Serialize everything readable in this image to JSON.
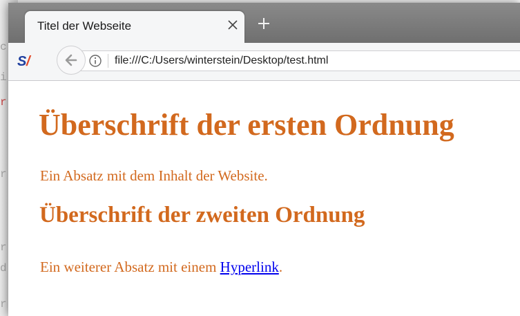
{
  "background_editor": {
    "fragments": [
      "c",
      "i",
      "r",
      "r",
      "r",
      "d",
      "r"
    ]
  },
  "browser": {
    "tab": {
      "title": "Titel der Webseite",
      "close_glyph": "×"
    },
    "new_tab_glyph": "+",
    "toolbar": {
      "extension_icon": "selfhtml-logo-icon",
      "back_icon": "back-arrow-icon",
      "info_icon": "info-icon"
    },
    "url": "file:///C:/Users/winterstein/Desktop/test.html"
  },
  "page": {
    "heading1": "Überschrift der ersten Ordnung",
    "paragraph1": "Ein Absatz mit dem Inhalt der Website.",
    "heading2": "Überschrift der zweiten Ordnung",
    "paragraph2_prefix": "Ein weiterer Absatz mit einem ",
    "link_text": "Hyperlink",
    "paragraph2_suffix": "."
  },
  "colors": {
    "text_accent": "#d2691e",
    "link": "#0000ee",
    "chrome_bg": "#f5f6f7",
    "tabbar_bg": "#7d7d7d"
  }
}
